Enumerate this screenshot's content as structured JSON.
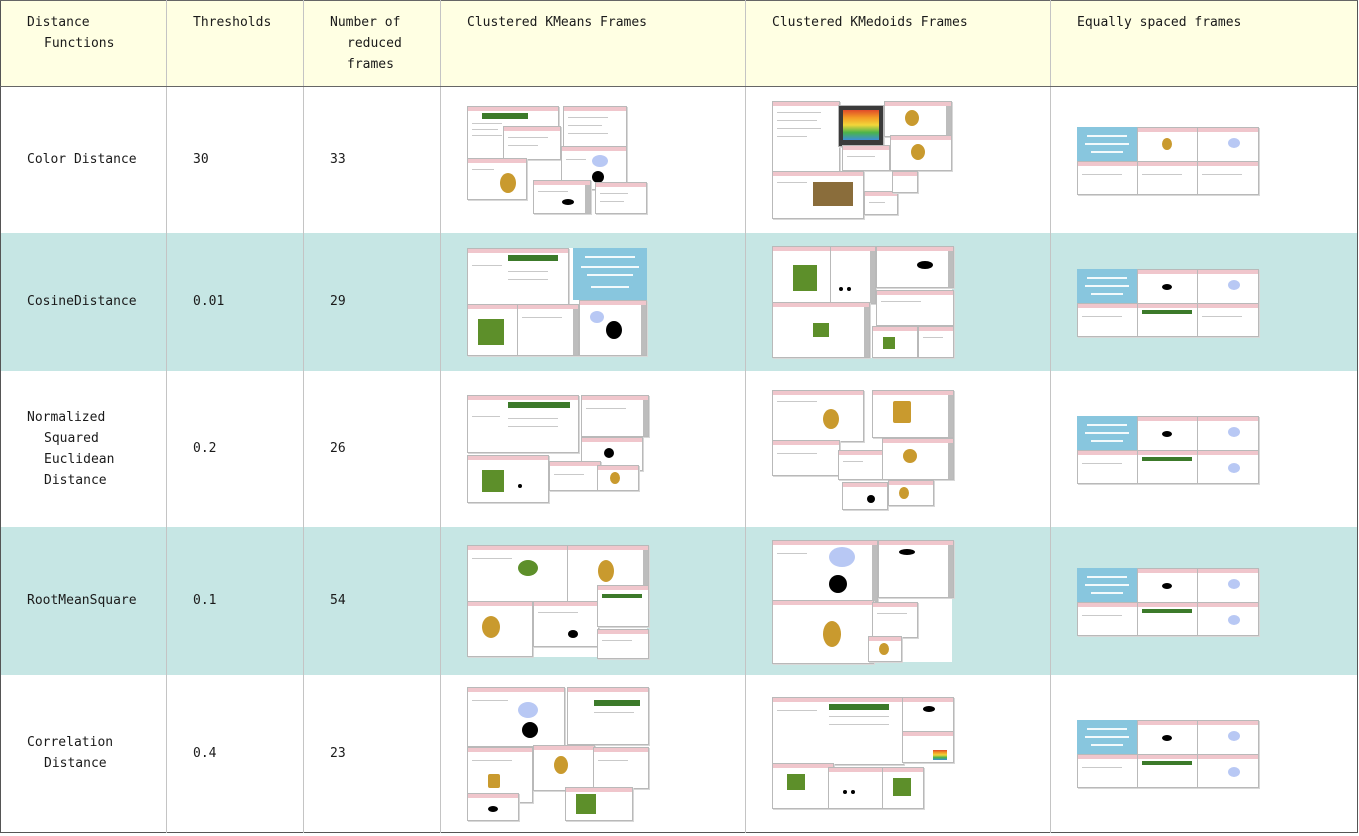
{
  "headers": {
    "distance_functions": "Distance Functions",
    "thresholds": "Thresholds",
    "num_reduced": "Number of reduced frames",
    "kmeans": "Clustered KMeans Frames",
    "kmedoids": "Clustered KMedoids Frames",
    "equal": "Equally spaced frames"
  },
  "rows": [
    {
      "fn": "Color Distance",
      "threshold": "30",
      "frames": "33"
    },
    {
      "fn": "CosineDistance",
      "threshold": "0.01",
      "frames": "29"
    },
    {
      "fn": "Normalized Squared Euclidean Distance",
      "threshold": "0.2",
      "frames": "26"
    },
    {
      "fn": "RootMeanSquare",
      "threshold": "0.1",
      "frames": "54"
    },
    {
      "fn": "Correlation Distance",
      "threshold": "0.4",
      "frames": "23"
    }
  ],
  "colors": {
    "header_bg": "#ffffe3",
    "row_alt_bg": "#c6e6e4",
    "row_bg": "#ffffff"
  }
}
